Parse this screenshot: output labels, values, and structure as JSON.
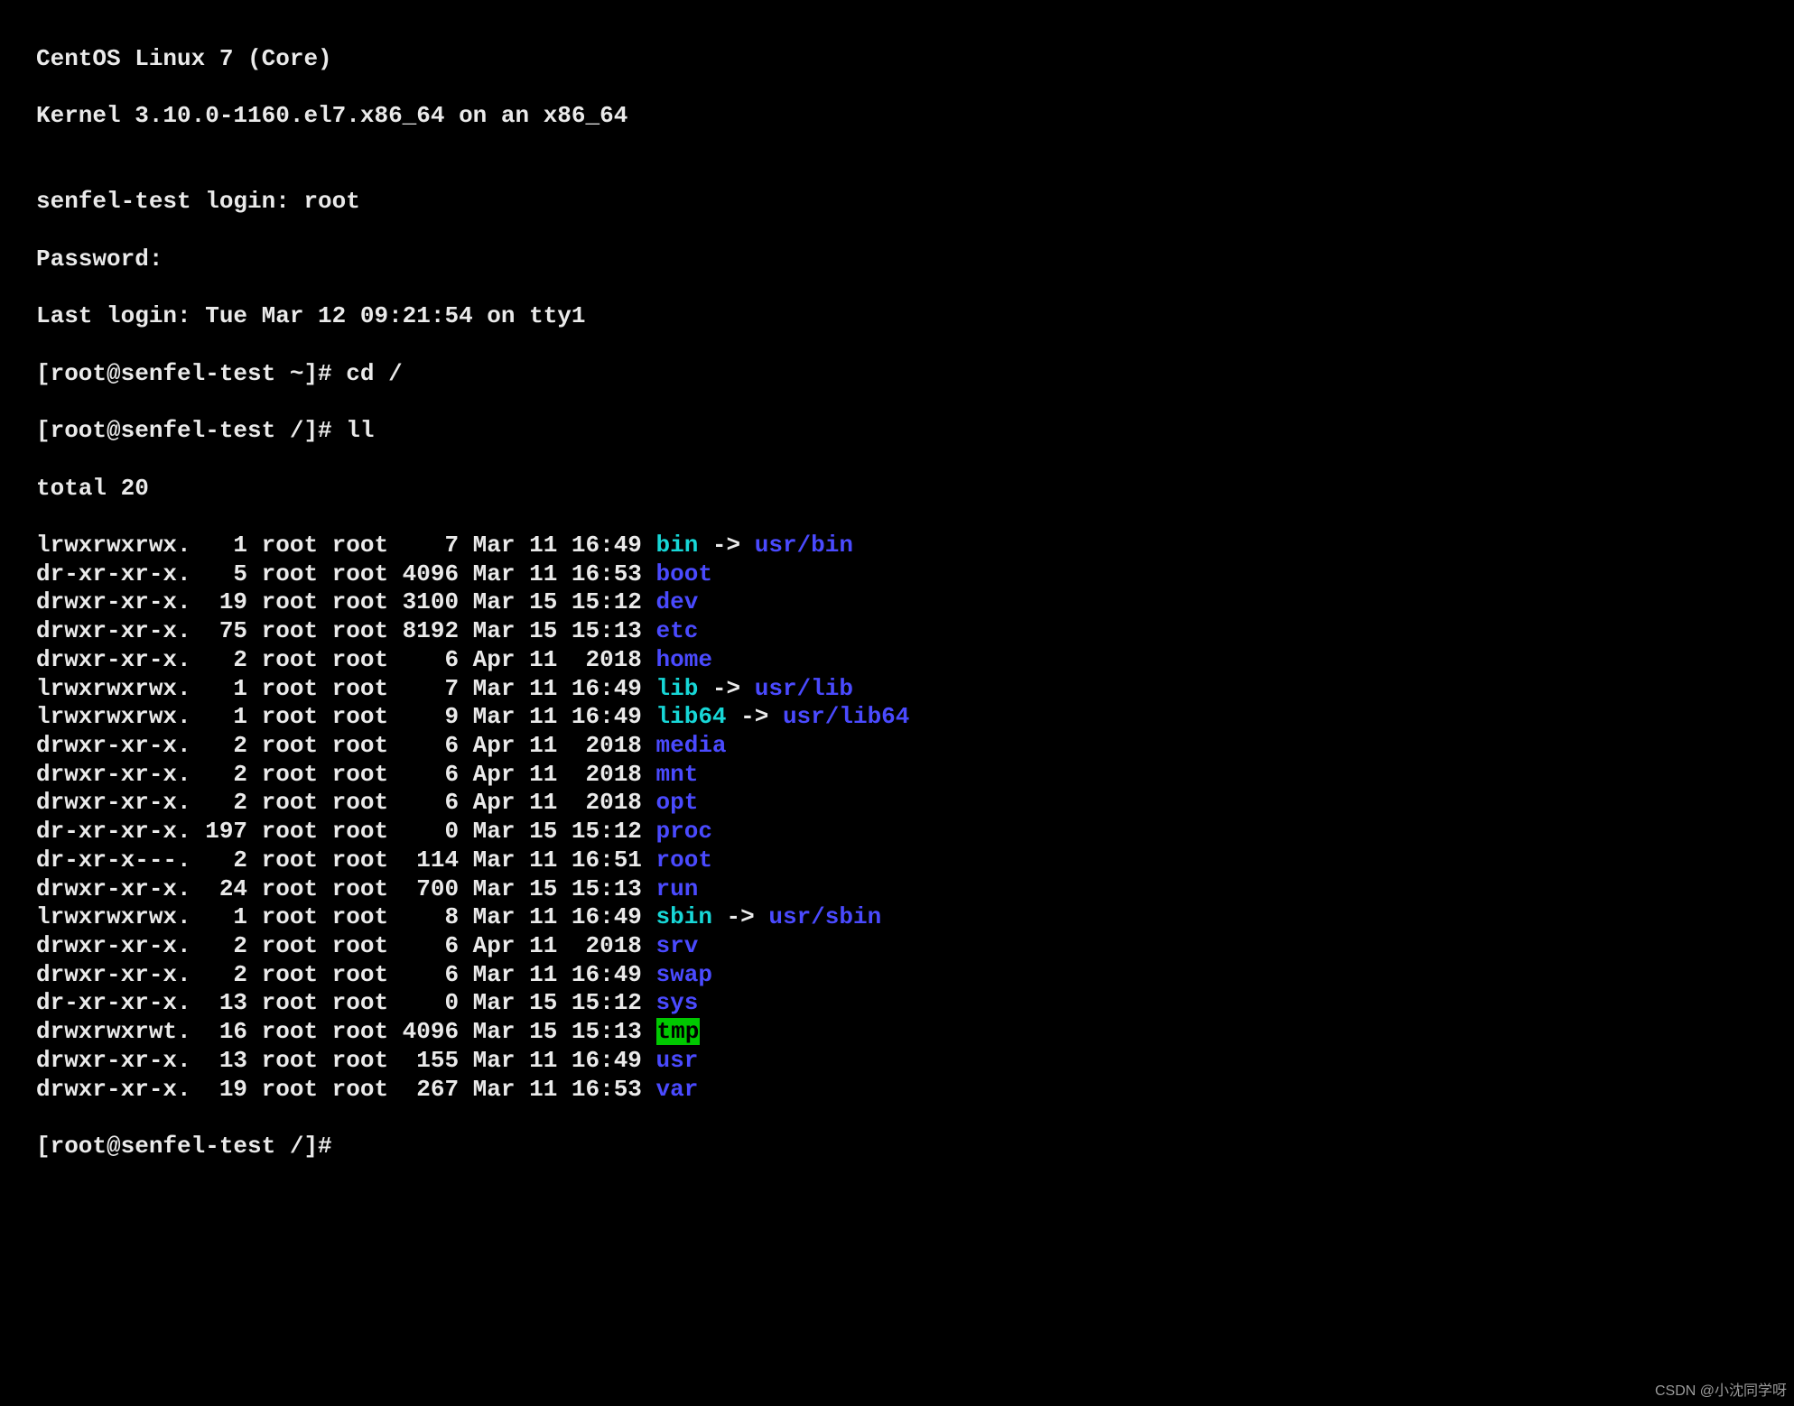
{
  "header": {
    "line1": "CentOS Linux 7 (Core)",
    "line2": "Kernel 3.10.0-1160.el7.x86_64 on an x86_64",
    "blank": "",
    "login_prompt": "senfel-test login: root",
    "password_prompt": "Password:",
    "last_login": "Last login: Tue Mar 12 09:21:54 on tty1"
  },
  "prompts": {
    "p1": "[root@senfel-test ~]# ",
    "c1": "cd /",
    "p2": "[root@senfel-test /]# ",
    "c2": "ll",
    "total": "total 20",
    "p3": "[root@senfel-test /]#"
  },
  "arrow": " -> ",
  "ll": [
    {
      "perm": "lrwxrwxrwx.",
      "links": "1",
      "owner": "root",
      "group": "root",
      "size": "7",
      "date": "Mar 11 16:49",
      "name": "bin",
      "color": "cyan",
      "target": "usr/bin",
      "tcolor": "blue"
    },
    {
      "perm": "dr-xr-xr-x.",
      "links": "5",
      "owner": "root",
      "group": "root",
      "size": "4096",
      "date": "Mar 11 16:53",
      "name": "boot",
      "color": "blue"
    },
    {
      "perm": "drwxr-xr-x.",
      "links": "19",
      "owner": "root",
      "group": "root",
      "size": "3100",
      "date": "Mar 15 15:12",
      "name": "dev",
      "color": "blue"
    },
    {
      "perm": "drwxr-xr-x.",
      "links": "75",
      "owner": "root",
      "group": "root",
      "size": "8192",
      "date": "Mar 15 15:13",
      "name": "etc",
      "color": "blue"
    },
    {
      "perm": "drwxr-xr-x.",
      "links": "2",
      "owner": "root",
      "group": "root",
      "size": "6",
      "date": "Apr 11  2018",
      "name": "home",
      "color": "blue"
    },
    {
      "perm": "lrwxrwxrwx.",
      "links": "1",
      "owner": "root",
      "group": "root",
      "size": "7",
      "date": "Mar 11 16:49",
      "name": "lib",
      "color": "cyan",
      "target": "usr/lib",
      "tcolor": "blue"
    },
    {
      "perm": "lrwxrwxrwx.",
      "links": "1",
      "owner": "root",
      "group": "root",
      "size": "9",
      "date": "Mar 11 16:49",
      "name": "lib64",
      "color": "cyan",
      "target": "usr/lib64",
      "tcolor": "blue"
    },
    {
      "perm": "drwxr-xr-x.",
      "links": "2",
      "owner": "root",
      "group": "root",
      "size": "6",
      "date": "Apr 11  2018",
      "name": "media",
      "color": "blue"
    },
    {
      "perm": "drwxr-xr-x.",
      "links": "2",
      "owner": "root",
      "group": "root",
      "size": "6",
      "date": "Apr 11  2018",
      "name": "mnt",
      "color": "blue"
    },
    {
      "perm": "drwxr-xr-x.",
      "links": "2",
      "owner": "root",
      "group": "root",
      "size": "6",
      "date": "Apr 11  2018",
      "name": "opt",
      "color": "blue"
    },
    {
      "perm": "dr-xr-xr-x.",
      "links": "197",
      "owner": "root",
      "group": "root",
      "size": "0",
      "date": "Mar 15 15:12",
      "name": "proc",
      "color": "blue"
    },
    {
      "perm": "dr-xr-x---.",
      "links": "2",
      "owner": "root",
      "group": "root",
      "size": "114",
      "date": "Mar 11 16:51",
      "name": "root",
      "color": "blue"
    },
    {
      "perm": "drwxr-xr-x.",
      "links": "24",
      "owner": "root",
      "group": "root",
      "size": "700",
      "date": "Mar 15 15:13",
      "name": "run",
      "color": "blue"
    },
    {
      "perm": "lrwxrwxrwx.",
      "links": "1",
      "owner": "root",
      "group": "root",
      "size": "8",
      "date": "Mar 11 16:49",
      "name": "sbin",
      "color": "cyan",
      "target": "usr/sbin",
      "tcolor": "blue"
    },
    {
      "perm": "drwxr-xr-x.",
      "links": "2",
      "owner": "root",
      "group": "root",
      "size": "6",
      "date": "Apr 11  2018",
      "name": "srv",
      "color": "blue"
    },
    {
      "perm": "drwxr-xr-x.",
      "links": "2",
      "owner": "root",
      "group": "root",
      "size": "6",
      "date": "Mar 11 16:49",
      "name": "swap",
      "color": "blue"
    },
    {
      "perm": "dr-xr-xr-x.",
      "links": "13",
      "owner": "root",
      "group": "root",
      "size": "0",
      "date": "Mar 15 15:12",
      "name": "sys",
      "color": "blue"
    },
    {
      "perm": "drwxrwxrwt.",
      "links": "16",
      "owner": "root",
      "group": "root",
      "size": "4096",
      "date": "Mar 15 15:13",
      "name": "tmp",
      "color": "green-bg"
    },
    {
      "perm": "drwxr-xr-x.",
      "links": "13",
      "owner": "root",
      "group": "root",
      "size": "155",
      "date": "Mar 11 16:49",
      "name": "usr",
      "color": "blue"
    },
    {
      "perm": "drwxr-xr-x.",
      "links": "19",
      "owner": "root",
      "group": "root",
      "size": "267",
      "date": "Mar 11 16:53",
      "name": "var",
      "color": "blue"
    }
  ],
  "watermark": "CSDN @小沈同学呀"
}
